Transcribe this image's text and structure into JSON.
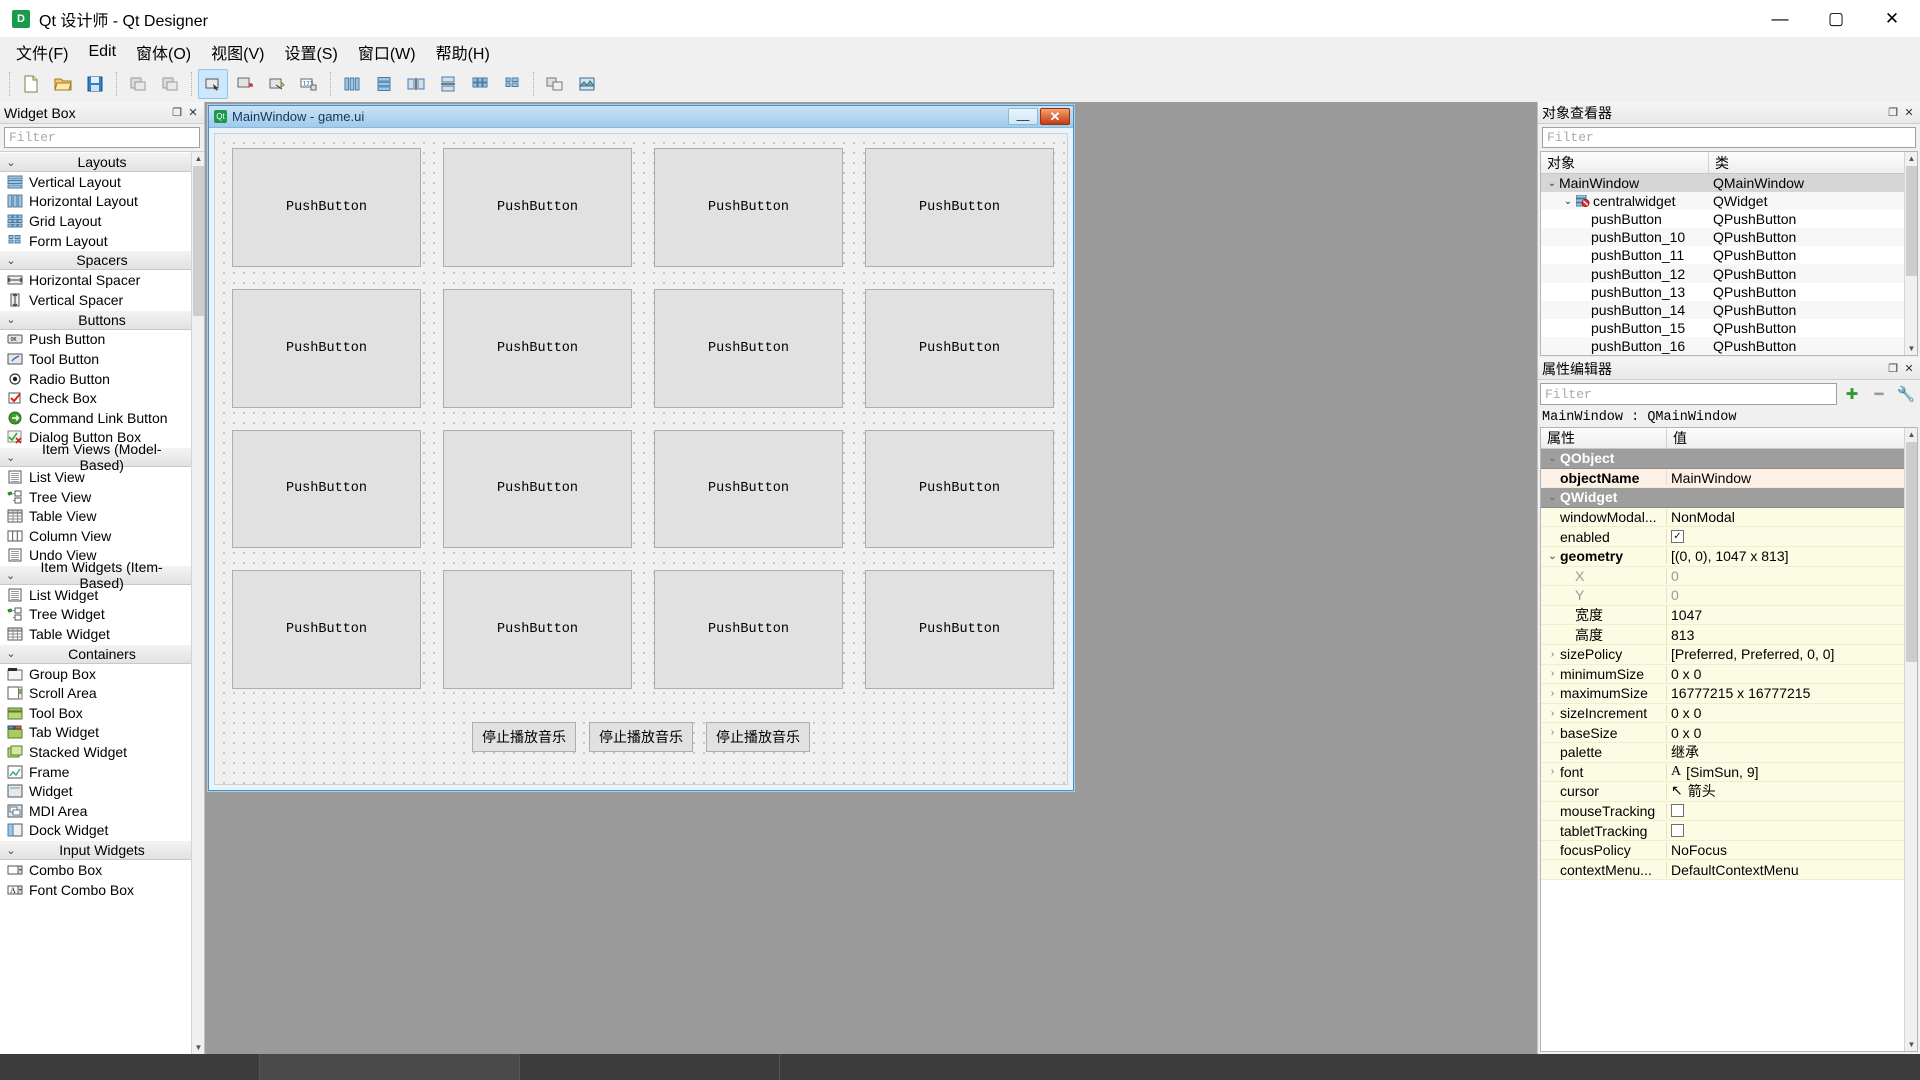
{
  "window": {
    "title": "Qt 设计师 - Qt Designer",
    "icon": "qt-logo-icon",
    "minimize": "—",
    "maximize": "▢",
    "close": "✕"
  },
  "menubar": [
    {
      "label": "文件(F)",
      "name": "menu-file"
    },
    {
      "label": "Edit",
      "name": "menu-edit"
    },
    {
      "label": "窗体(O)",
      "name": "menu-form"
    },
    {
      "label": "视图(V)",
      "name": "menu-view"
    },
    {
      "label": "设置(S)",
      "name": "menu-settings"
    },
    {
      "label": "窗口(W)",
      "name": "menu-window"
    },
    {
      "label": "帮助(H)",
      "name": "menu-help"
    }
  ],
  "toolbar": {
    "groups": [
      [
        "new-file-icon",
        "open-file-icon",
        "save-file-icon"
      ],
      [
        "undo-icon",
        "redo-icon"
      ],
      [
        "edit-widgets-icon",
        "edit-signals-slots-icon",
        "edit-buddies-icon",
        "edit-tab-order-icon"
      ],
      [
        "layout-horizontally-icon",
        "layout-vertically-icon",
        "layout-splitter-h-icon",
        "layout-splitter-v-icon",
        "layout-grid-icon",
        "layout-form-icon"
      ],
      [
        "break-layout-icon",
        "adjust-size-icon"
      ]
    ]
  },
  "widget_box": {
    "panel_title": "Widget Box",
    "float_btn": "❐",
    "close_btn": "✕",
    "filter_placeholder": "Filter",
    "groups": [
      {
        "name": "Layouts",
        "items": [
          {
            "label": "Vertical Layout",
            "icon": "vertical-layout-icon"
          },
          {
            "label": "Horizontal Layout",
            "icon": "horizontal-layout-icon"
          },
          {
            "label": "Grid Layout",
            "icon": "grid-layout-icon"
          },
          {
            "label": "Form Layout",
            "icon": "form-layout-icon"
          }
        ]
      },
      {
        "name": "Spacers",
        "items": [
          {
            "label": "Horizontal Spacer",
            "icon": "horizontal-spacer-icon"
          },
          {
            "label": "Vertical Spacer",
            "icon": "vertical-spacer-icon"
          }
        ]
      },
      {
        "name": "Buttons",
        "items": [
          {
            "label": "Push Button",
            "icon": "push-button-icon"
          },
          {
            "label": "Tool Button",
            "icon": "tool-button-icon"
          },
          {
            "label": "Radio Button",
            "icon": "radio-button-icon"
          },
          {
            "label": "Check Box",
            "icon": "check-box-icon"
          },
          {
            "label": "Command Link Button",
            "icon": "command-link-button-icon"
          },
          {
            "label": "Dialog Button Box",
            "icon": "dialog-button-box-icon"
          }
        ]
      },
      {
        "name": "Item Views (Model-Based)",
        "items": [
          {
            "label": "List View",
            "icon": "list-view-icon"
          },
          {
            "label": "Tree View",
            "icon": "tree-view-icon"
          },
          {
            "label": "Table View",
            "icon": "table-view-icon"
          },
          {
            "label": "Column View",
            "icon": "column-view-icon"
          },
          {
            "label": "Undo View",
            "icon": "undo-view-icon"
          }
        ]
      },
      {
        "name": "Item Widgets (Item-Based)",
        "items": [
          {
            "label": "List Widget",
            "icon": "list-widget-icon"
          },
          {
            "label": "Tree Widget",
            "icon": "tree-widget-icon"
          },
          {
            "label": "Table Widget",
            "icon": "table-widget-icon"
          }
        ]
      },
      {
        "name": "Containers",
        "items": [
          {
            "label": "Group Box",
            "icon": "group-box-icon"
          },
          {
            "label": "Scroll Area",
            "icon": "scroll-area-icon"
          },
          {
            "label": "Tool Box",
            "icon": "tool-box-icon"
          },
          {
            "label": "Tab Widget",
            "icon": "tab-widget-icon"
          },
          {
            "label": "Stacked Widget",
            "icon": "stacked-widget-icon"
          },
          {
            "label": "Frame",
            "icon": "frame-icon"
          },
          {
            "label": "Widget",
            "icon": "widget-icon"
          },
          {
            "label": "MDI Area",
            "icon": "mdi-area-icon"
          },
          {
            "label": "Dock Widget",
            "icon": "dock-widget-icon"
          }
        ]
      },
      {
        "name": "Input Widgets",
        "items": [
          {
            "label": "Combo Box",
            "icon": "combo-box-icon"
          },
          {
            "label": "Font Combo Box",
            "icon": "font-combo-box-icon"
          }
        ]
      }
    ]
  },
  "form_window": {
    "title": "MainWindow - game.ui",
    "icon": "qt-ui-file-icon",
    "minimize": "—",
    "close": "✕",
    "buttons": [
      "PushButton",
      "PushButton",
      "PushButton",
      "PushButton",
      "PushButton",
      "PushButton",
      "PushButton",
      "PushButton",
      "PushButton",
      "PushButton",
      "PushButton",
      "PushButton",
      "PushButton",
      "PushButton",
      "PushButton",
      "PushButton"
    ],
    "music_buttons": [
      "停止播放音乐",
      "停止播放音乐",
      "停止播放音乐"
    ]
  },
  "object_inspector": {
    "panel_title": "对象查看器",
    "float_btn": "❐",
    "close_btn": "✕",
    "filter_placeholder": "Filter",
    "columns": [
      "对象",
      "类"
    ],
    "rows": [
      {
        "name": "MainWindow",
        "class": "QMainWindow",
        "indent": 0,
        "chevron": "⌄",
        "icon": "",
        "selected": true
      },
      {
        "name": "centralwidget",
        "class": "QWidget",
        "indent": 1,
        "chevron": "⌄",
        "icon": "no-layout-icon",
        "selected": false
      },
      {
        "name": "pushButton",
        "class": "QPushButton",
        "indent": 2,
        "chevron": "",
        "icon": "",
        "selected": false
      },
      {
        "name": "pushButton_10",
        "class": "QPushButton",
        "indent": 2,
        "chevron": "",
        "icon": "",
        "selected": false
      },
      {
        "name": "pushButton_11",
        "class": "QPushButton",
        "indent": 2,
        "chevron": "",
        "icon": "",
        "selected": false
      },
      {
        "name": "pushButton_12",
        "class": "QPushButton",
        "indent": 2,
        "chevron": "",
        "icon": "",
        "selected": false
      },
      {
        "name": "pushButton_13",
        "class": "QPushButton",
        "indent": 2,
        "chevron": "",
        "icon": "",
        "selected": false
      },
      {
        "name": "pushButton_14",
        "class": "QPushButton",
        "indent": 2,
        "chevron": "",
        "icon": "",
        "selected": false
      },
      {
        "name": "pushButton_15",
        "class": "QPushButton",
        "indent": 2,
        "chevron": "",
        "icon": "",
        "selected": false
      },
      {
        "name": "pushButton_16",
        "class": "QPushButton",
        "indent": 2,
        "chevron": "",
        "icon": "",
        "selected": false
      }
    ]
  },
  "property_editor": {
    "panel_title": "属性编辑器",
    "float_btn": "❐",
    "close_btn": "✕",
    "filter_placeholder": "Filter",
    "add_btn": "✚",
    "remove_btn": "━",
    "config_btn": "🔧",
    "object_line": "MainWindow : QMainWindow",
    "columns": [
      "属性",
      "值"
    ],
    "rows": [
      {
        "kind": "group",
        "name": "QObject",
        "value": "",
        "chevron": "⌄",
        "indent": 0
      },
      {
        "kind": "pink",
        "name": "objectName",
        "value": "MainWindow",
        "chevron": "",
        "indent": 1
      },
      {
        "kind": "group",
        "name": "QWidget",
        "value": "",
        "chevron": "⌄",
        "indent": 0
      },
      {
        "kind": "yel",
        "name": "windowModal...",
        "value": "NonModal",
        "chevron": "",
        "indent": 1
      },
      {
        "kind": "yel",
        "name": "enabled",
        "value": "",
        "chevron": "",
        "indent": 1,
        "checkbox": true,
        "checked": true
      },
      {
        "kind": "yel",
        "name": "geometry",
        "value": "[(0, 0), 1047 x 813]",
        "chevron": "⌄",
        "indent": 0,
        "bold": true
      },
      {
        "kind": "dim",
        "name": "X",
        "value": "0",
        "chevron": "",
        "indent": 2
      },
      {
        "kind": "dim",
        "name": "Y",
        "value": "0",
        "chevron": "",
        "indent": 2
      },
      {
        "kind": "yel",
        "name": "宽度",
        "value": "1047",
        "chevron": "",
        "indent": 2
      },
      {
        "kind": "yel",
        "name": "高度",
        "value": "813",
        "chevron": "",
        "indent": 2
      },
      {
        "kind": "yel",
        "name": "sizePolicy",
        "value": "[Preferred, Preferred, 0, 0]",
        "chevron": "›",
        "indent": 0
      },
      {
        "kind": "yel",
        "name": "minimumSize",
        "value": "0 x 0",
        "chevron": "›",
        "indent": 0
      },
      {
        "kind": "yel",
        "name": "maximumSize",
        "value": "16777215 x 16777215",
        "chevron": "›",
        "indent": 0
      },
      {
        "kind": "yel",
        "name": "sizeIncrement",
        "value": "0 x 0",
        "chevron": "›",
        "indent": 0
      },
      {
        "kind": "yel",
        "name": "baseSize",
        "value": "0 x 0",
        "chevron": "›",
        "indent": 0
      },
      {
        "kind": "yel",
        "name": "palette",
        "value": "继承",
        "chevron": "",
        "indent": 1
      },
      {
        "kind": "yel",
        "name": "font",
        "value": "[SimSun, 9]",
        "chevron": "›",
        "indent": 0,
        "prefix": "A"
      },
      {
        "kind": "yel",
        "name": "cursor",
        "value": "箭头",
        "chevron": "",
        "indent": 1,
        "prefix": "↖"
      },
      {
        "kind": "yel",
        "name": "mouseTracking",
        "value": "",
        "chevron": "",
        "indent": 1,
        "checkbox": true,
        "checked": false
      },
      {
        "kind": "yel",
        "name": "tabletTracking",
        "value": "",
        "chevron": "",
        "indent": 1,
        "checkbox": true,
        "checked": false
      },
      {
        "kind": "yel",
        "name": "focusPolicy",
        "value": "NoFocus",
        "chevron": "",
        "indent": 1
      },
      {
        "kind": "yel",
        "name": "contextMenu...",
        "value": "DefaultContextMenu",
        "chevron": "",
        "indent": 1
      }
    ]
  },
  "colors": {
    "accent": "#4a90c2",
    "selection": "#cce8ff",
    "prop_yellow": "#fcfbe3",
    "prop_pink": "#fdf0e6",
    "group_gray": "#9e9e9e",
    "canvas_gray": "#9a9a9a"
  }
}
